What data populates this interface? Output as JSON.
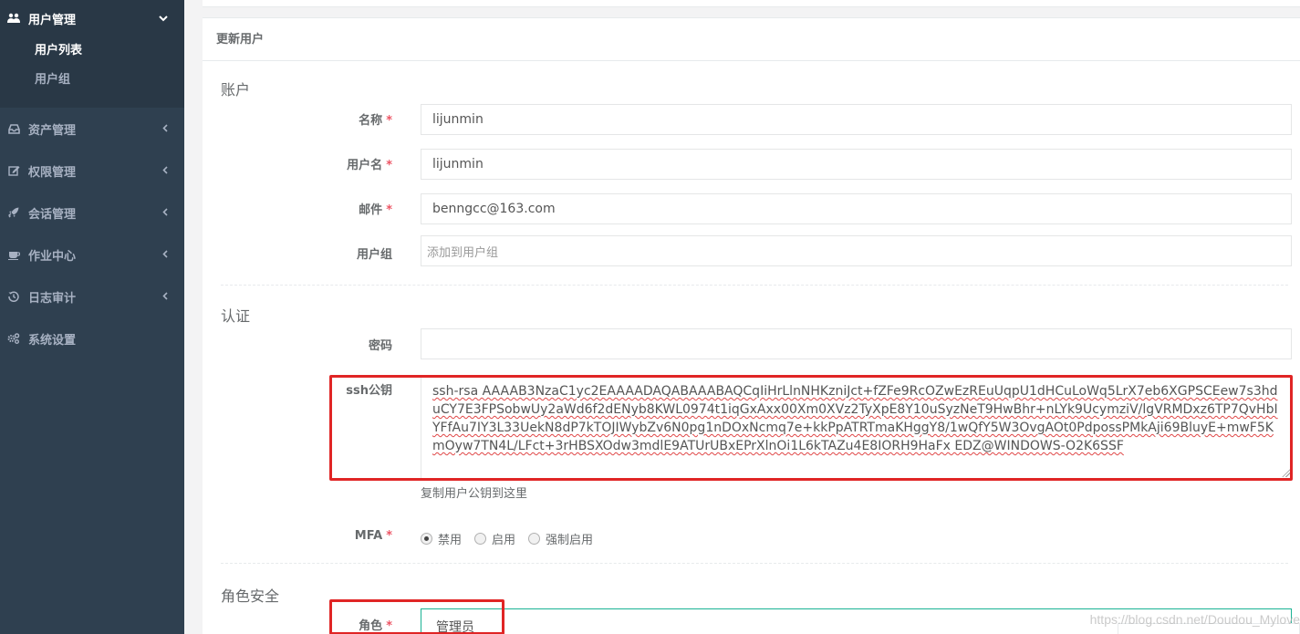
{
  "sidebar": {
    "open_group": {
      "label": "用户管理",
      "icon": "users-icon",
      "items": [
        {
          "label": "用户列表",
          "active": true
        },
        {
          "label": "用户组",
          "active": false
        }
      ]
    },
    "groups": [
      {
        "label": "资产管理",
        "icon": "inbox-icon"
      },
      {
        "label": "权限管理",
        "icon": "edit-icon"
      },
      {
        "label": "会话管理",
        "icon": "rocket-icon"
      },
      {
        "label": "作业中心",
        "icon": "coffee-icon"
      },
      {
        "label": "日志审计",
        "icon": "history-icon"
      },
      {
        "label": "系统设置",
        "icon": "gears-icon"
      }
    ]
  },
  "panel": {
    "title": "更新用户"
  },
  "form": {
    "section_account": "账户",
    "name_label": "名称",
    "name_value": "lijunmin",
    "username_label": "用户名",
    "username_value": "lijunmin",
    "email_label": "邮件",
    "email_value": "benngcc@163.com",
    "group_label": "用户组",
    "group_placeholder": "添加到用户组",
    "section_auth": "认证",
    "password_label": "密码",
    "password_value": "",
    "ssh_label": "ssh公钥",
    "ssh_value": "ssh-rsa AAAAB3NzaC1yc2EAAAADAQABAAABAQCqIiHrLlnNHKzniJct+fZFe9RcOZwEzREuUqpU1dHCuLoWq5LrX7eb6XGPSCEew7s3hduCY7E3FPSobwUy2aWd6f2dENyb8KWL0974t1iqGxAxx00Xm0XVz2TyXpE8Y10uSyzNeT9HwBhr+nLYk9UcymziV/lgVRMDxz6TP7QvHbIYFfAu7IY3L33UekN8dP7kTOJIWybZv6N0pg1nDOxNcmq7e+kkPpATRTmaKHggY8/1wQfY5W3OvgAOt0PdpossPMkAji69BluyE+mwF5KmOyw7TN4L/LFct+3rHBSXOdw3mdlE9ATUrUBxEPrXlnOi1L6kTAZu4E8IORH9HaFx EDZ@WINDOWS-O2K6SSF",
    "ssh_help": "复制用户公钥到这里",
    "mfa_label": "MFA",
    "mfa_options": [
      {
        "label": "禁用",
        "checked": true
      },
      {
        "label": "启用",
        "checked": false
      },
      {
        "label": "强制启用",
        "checked": false
      }
    ],
    "section_role": "角色安全",
    "role_label": "角色",
    "role_value": "管理员",
    "required_mark": "*"
  },
  "watermark": "https://blog.csdn.net/Doudou_Mylove",
  "colors": {
    "sidebar_bg": "#2f4050",
    "sidebar_open_bg": "#293846",
    "required": "#ed5565",
    "annotation_red": "#e02525",
    "focus_border": "#1ab394"
  }
}
